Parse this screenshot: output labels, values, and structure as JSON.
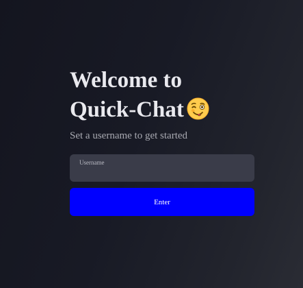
{
  "login": {
    "title_line1": "Welcome to",
    "title_line2": "Quick-Chat",
    "title_emoji": "winking-face-with-tongue",
    "subtitle": "Set a username to get started",
    "username_label": "Username",
    "username_value": "",
    "enter_label": "Enter"
  },
  "colors": {
    "background": "#181a25",
    "field_background": "#3a3c49",
    "button": "#0000ff",
    "title_text": "#e9e9ee",
    "subtitle_text": "#a9aab2"
  }
}
